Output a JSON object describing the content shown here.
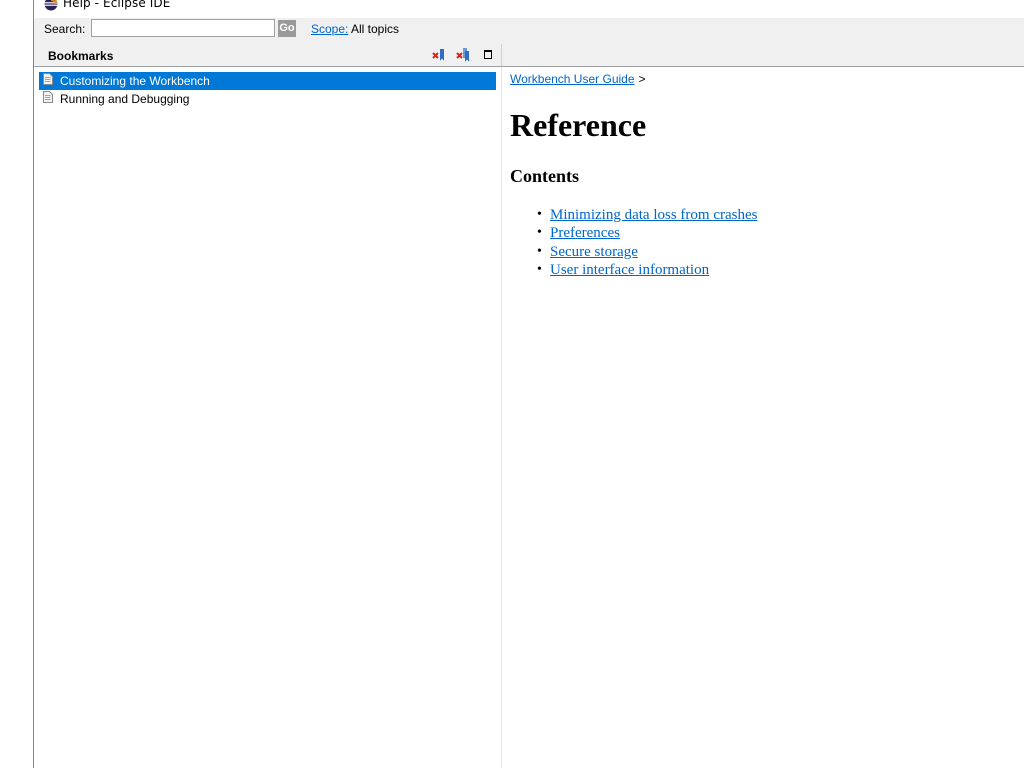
{
  "window": {
    "title": "Help - Eclipse IDE"
  },
  "search": {
    "label": "Search:",
    "value": "",
    "placeholder": "",
    "go_label": "Go",
    "scope_link": "Scope:",
    "scope_value": "All topics"
  },
  "toolbar": {
    "view_title": "Bookmarks",
    "icons": [
      "delete-bookmark-icon",
      "delete-all-bookmarks-icon",
      "maximize-icon"
    ]
  },
  "bookmarks": {
    "items": [
      {
        "label": "Customizing the Workbench",
        "selected": true,
        "icon": "document-icon"
      },
      {
        "label": "Running and Debugging",
        "selected": false,
        "icon": "document-icon"
      }
    ]
  },
  "content": {
    "breadcrumb": {
      "link": "Workbench User Guide",
      "separator": ">"
    },
    "title": "Reference",
    "section": "Contents",
    "links": [
      "Minimizing data loss from crashes",
      "Preferences",
      "Secure storage",
      "User interface information"
    ]
  },
  "colors": {
    "selection": "#0078d7",
    "link": "#0066cc",
    "chrome": "#f0f0f0"
  }
}
